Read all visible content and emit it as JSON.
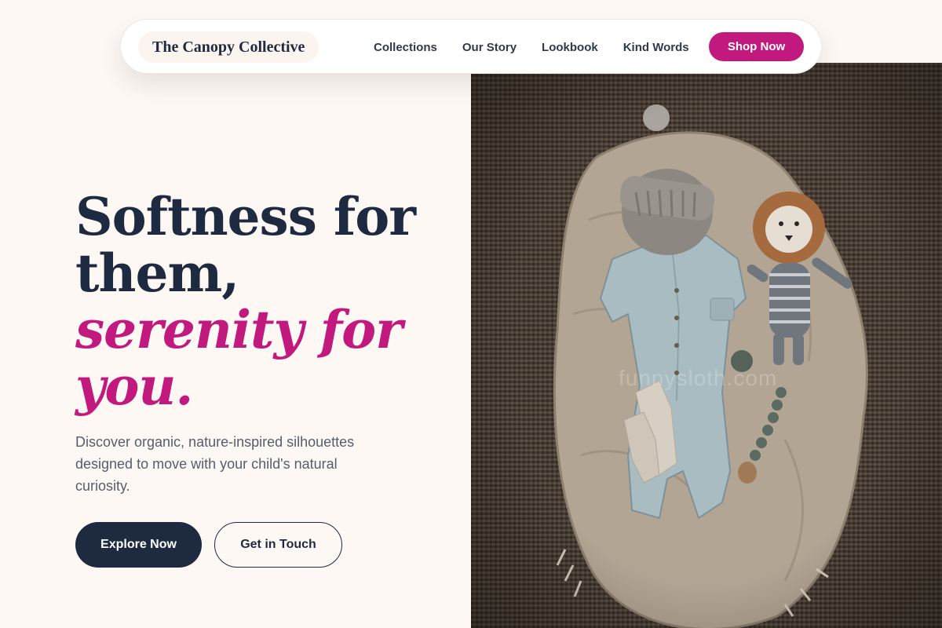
{
  "header": {
    "brand": "The Canopy Collective",
    "nav": [
      {
        "label": "Collections"
      },
      {
        "label": "Our Story"
      },
      {
        "label": "Lookbook"
      },
      {
        "label": "Kind Words"
      }
    ],
    "cta_label": "Shop Now"
  },
  "hero": {
    "title_line1": "Softness for",
    "title_line2": "them,",
    "title_accent_line1": "serenity for",
    "title_accent_line2": "you.",
    "subtitle": "Discover organic, nature-inspired silhouettes designed to move with your child's natural curiosity.",
    "primary_button": "Explore Now",
    "secondary_button": "Get in Touch"
  },
  "image": {
    "watermark": "funnysloth.com"
  },
  "colors": {
    "background": "#fdf8f4",
    "navy": "#1e2a40",
    "accent": "#c2197f",
    "body_text": "#555e6d"
  }
}
